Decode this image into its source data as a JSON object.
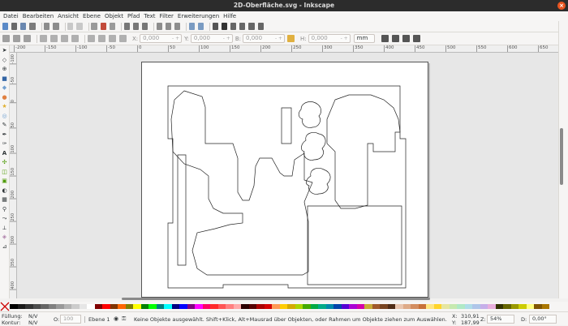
{
  "window": {
    "title": "2D-Oberfläche.svg - Inkscape"
  },
  "menu": [
    "Datei",
    "Bearbeiten",
    "Ansicht",
    "Ebene",
    "Objekt",
    "Pfad",
    "Text",
    "Filter",
    "Erweiterungen",
    "Hilfe"
  ],
  "toolbar2": {
    "x_label": "X:",
    "x_value": "0,000",
    "y_label": "Y:",
    "y_value": "0,000",
    "w_label": "B:",
    "w_value": "0,000",
    "h_label": "H:",
    "h_value": "0,000",
    "unit": "mm"
  },
  "ruler_top": [
    "-200",
    "-150",
    "-100",
    "-50",
    "0",
    "50",
    "100",
    "150",
    "200",
    "250",
    "300",
    "350",
    "400",
    "450",
    "500",
    "550",
    "600",
    "650"
  ],
  "ruler_left": [
    "-100",
    "-50",
    "0",
    "50",
    "100",
    "150",
    "200",
    "250",
    "300",
    "350",
    "400"
  ],
  "status": {
    "fill_label": "Füllung:",
    "fill_value": "N/V",
    "stroke_label": "Kontur:",
    "stroke_value": "N/V",
    "opacity_label": "O:",
    "opacity_value": "100",
    "layer": "Ebene 1",
    "message": "Keine Objekte ausgewählt. Shift+Klick, Alt+Mausrad über Objekten, oder Rahmen um Objekte ziehen zum Auswählen.",
    "x_label": "X:",
    "x_value": "310,91",
    "y_label": "Y:",
    "y_value": "187,99",
    "zoom_label": "Z:",
    "zoom_value": "54%",
    "rotation_label": "D:",
    "rotation_value": "0,00°"
  },
  "colors": {
    "accent": "#e95420",
    "palette": [
      "#000000",
      "#1a1a1a",
      "#333333",
      "#4d4d4d",
      "#666666",
      "#808080",
      "#999999",
      "#b3b3b3",
      "#cccccc",
      "#e6e6e6",
      "#ffffff",
      "#800000",
      "#ff0000",
      "#803300",
      "#ff6600",
      "#808000",
      "#ffff00",
      "#008000",
      "#00ff00",
      "#008080",
      "#00ffff",
      "#000080",
      "#0000ff",
      "#800080",
      "#ff00ff",
      "#ff0066",
      "#ff2a2a",
      "#ff5555",
      "#ff8080",
      "#ffaaaa",
      "#2b0000",
      "#550000",
      "#aa0000",
      "#d40000",
      "#ff9955",
      "#ffcc00",
      "#d4aa00",
      "#aad400",
      "#44aa00",
      "#00aa44",
      "#00aa88",
      "#0088aa",
      "#0044aa",
      "#5500d4",
      "#aa00d4",
      "#d400aa",
      "#c8ab37",
      "#a05a2c",
      "#784421",
      "#502d16",
      "#e9c6af",
      "#deaa87",
      "#d38d5f",
      "#c87137",
      "#ffe680",
      "#ffd42a",
      "#e6e6a0",
      "#c6e9af",
      "#afe9c6",
      "#afdde9",
      "#afc6e9",
      "#c6afe9",
      "#e9afdd",
      "#333300",
      "#666600",
      "#999900",
      "#cccc00",
      "#ffff80",
      "#805500",
      "#aa7700"
    ]
  }
}
